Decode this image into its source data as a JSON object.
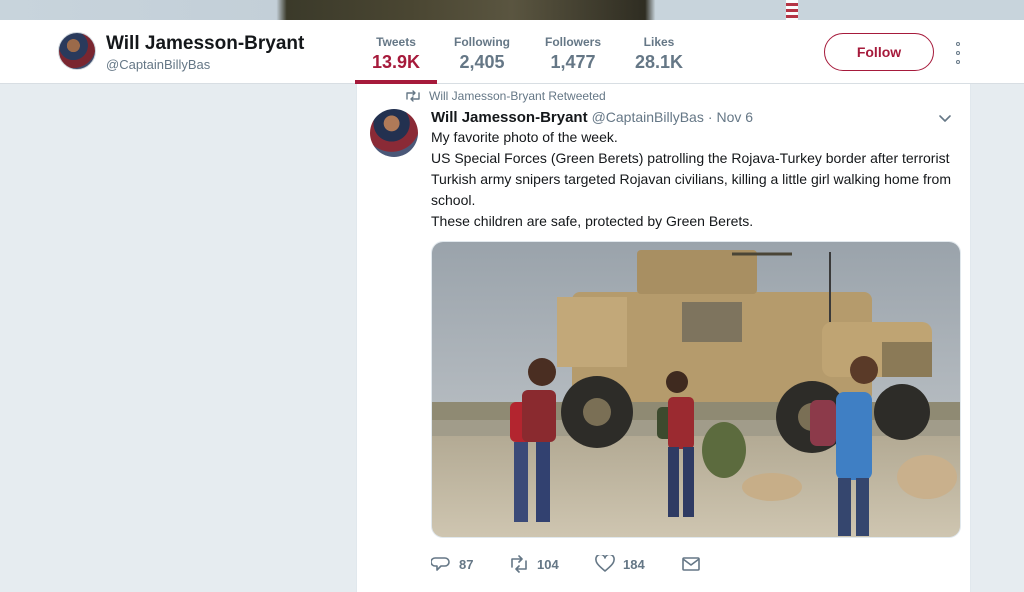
{
  "profile": {
    "name": "Will Jamesson-Bryant",
    "handle": "@CaptainBillyBas",
    "follow_label": "Follow"
  },
  "stats": [
    {
      "label": "Tweets",
      "value": "13.9K",
      "active": true
    },
    {
      "label": "Following",
      "value": "2,405",
      "active": false
    },
    {
      "label": "Followers",
      "value": "1,477",
      "active": false
    },
    {
      "label": "Likes",
      "value": "28.1K",
      "active": false
    }
  ],
  "tweet": {
    "retweet_context": "Will Jamesson-Bryant Retweeted",
    "author_name": "Will Jamesson-Bryant",
    "author_handle": "@CaptainBillyBas",
    "separator": "·",
    "time": "Nov 6",
    "lines": [
      "My favorite photo of the week.",
      "US Special Forces (Green Berets) patrolling the Rojava-Turkey border after terrorist Turkish army snipers targeted Rojavan civilians, killing a little girl walking home from school.",
      "These children are safe, protected by Green Berets."
    ],
    "actions": {
      "replies": "87",
      "retweets": "104",
      "likes": "184"
    }
  },
  "colors": {
    "accent": "#a61a3b",
    "background": "#e6ecf0",
    "muted": "#657786"
  },
  "icons": {
    "retweet_context": "retweet-icon",
    "caret": "chevron-down-icon",
    "reply": "reply-icon",
    "retweet": "retweet-icon",
    "like": "heart-icon",
    "dm": "envelope-icon",
    "more": "more-vertical-icon"
  }
}
